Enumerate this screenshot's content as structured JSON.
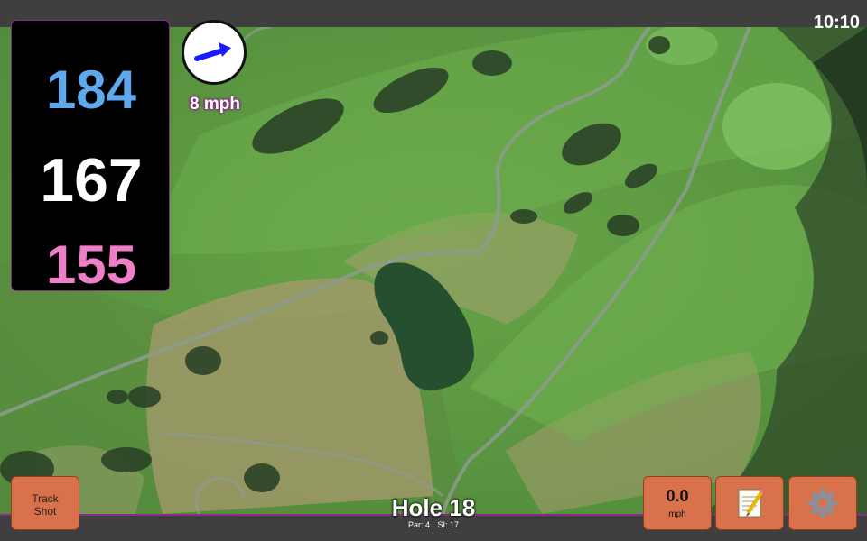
{
  "status": {
    "time": "10:10"
  },
  "distances": {
    "back": "184",
    "middle": "167",
    "front": "155"
  },
  "wind": {
    "label": "8 mph",
    "direction": "arrow-east-northeast-icon"
  },
  "buttons": {
    "track_shot": "Track\nShot",
    "wind_value": "0.0",
    "wind_unit": "mph",
    "notes": "notepad-icon",
    "settings": "gear-icon"
  },
  "hole": {
    "title": "Hole 18",
    "par": "Par: 4",
    "si": "SI: 17"
  },
  "colors": {
    "back_distance": "#5ea8ee",
    "middle_distance": "#ffffff",
    "front_distance": "#ef7ec9",
    "button": "#d9714a",
    "accent_border": "#8a2a8a",
    "wind_arrow": "#1a1aff"
  }
}
